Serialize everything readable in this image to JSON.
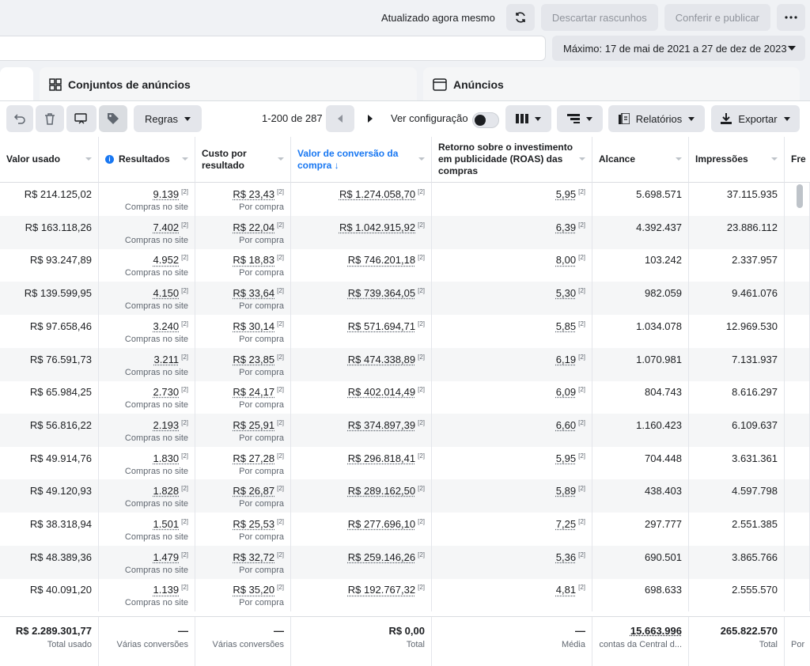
{
  "topbar": {
    "updated": "Atualizado agora mesmo",
    "discard": "Descartar rascunhos",
    "publish": "Conferir e publicar"
  },
  "date_range": "Máximo: 17 de mai de 2021 a 27 de dez de 2023",
  "tabs": {
    "adsets": "Conjuntos de anúncios",
    "ads": "Anúncios"
  },
  "toolbar": {
    "rules": "Regras",
    "page_range": "1-200 de 287",
    "view_config": "Ver configuração",
    "reports": "Relatórios",
    "export": "Exportar"
  },
  "columns": {
    "spent": "Valor usado",
    "results": "Resultados",
    "cost": "Custo por resultado",
    "conv_value": "Valor de conversão da compra ↓",
    "roas": "Retorno sobre o investimento em publicidade (ROAS) das compras",
    "reach": "Alcance",
    "impressions": "Impressões",
    "freq": "Fre"
  },
  "ref_mark": "[2]",
  "sub_results": "Compras no site",
  "sub_cost": "Por compra",
  "rows": [
    {
      "spent": "R$ 214.125,02",
      "results": "9.139",
      "cost": "R$ 23,43",
      "conv": "R$ 1.274.058,70",
      "roas": "5,95",
      "reach": "5.698.571",
      "impr": "37.115.935"
    },
    {
      "spent": "R$ 163.118,26",
      "results": "7.402",
      "cost": "R$ 22,04",
      "conv": "R$ 1.042.915,92",
      "roas": "6,39",
      "reach": "4.392.437",
      "impr": "23.886.112"
    },
    {
      "spent": "R$ 93.247,89",
      "results": "4.952",
      "cost": "R$ 18,83",
      "conv": "R$ 746.201,18",
      "roas": "8,00",
      "reach": "103.242",
      "impr": "2.337.957"
    },
    {
      "spent": "R$ 139.599,95",
      "results": "4.150",
      "cost": "R$ 33,64",
      "conv": "R$ 739.364,05",
      "roas": "5,30",
      "reach": "982.059",
      "impr": "9.461.076"
    },
    {
      "spent": "R$ 97.658,46",
      "results": "3.240",
      "cost": "R$ 30,14",
      "conv": "R$ 571.694,71",
      "roas": "5,85",
      "reach": "1.034.078",
      "impr": "12.969.530"
    },
    {
      "spent": "R$ 76.591,73",
      "results": "3.211",
      "cost": "R$ 23,85",
      "conv": "R$ 474.338,89",
      "roas": "6,19",
      "reach": "1.070.981",
      "impr": "7.131.937"
    },
    {
      "spent": "R$ 65.984,25",
      "results": "2.730",
      "cost": "R$ 24,17",
      "conv": "R$ 402.014,49",
      "roas": "6,09",
      "reach": "804.743",
      "impr": "8.616.297"
    },
    {
      "spent": "R$ 56.816,22",
      "results": "2.193",
      "cost": "R$ 25,91",
      "conv": "R$ 374.897,39",
      "roas": "6,60",
      "reach": "1.160.423",
      "impr": "6.109.637"
    },
    {
      "spent": "R$ 49.914,76",
      "results": "1.830",
      "cost": "R$ 27,28",
      "conv": "R$ 296.818,41",
      "roas": "5,95",
      "reach": "704.448",
      "impr": "3.631.361"
    },
    {
      "spent": "R$ 49.120,93",
      "results": "1.828",
      "cost": "R$ 26,87",
      "conv": "R$ 289.162,50",
      "roas": "5,89",
      "reach": "438.403",
      "impr": "4.597.798"
    },
    {
      "spent": "R$ 38.318,94",
      "results": "1.501",
      "cost": "R$ 25,53",
      "conv": "R$ 277.696,10",
      "roas": "7,25",
      "reach": "297.777",
      "impr": "2.551.385"
    },
    {
      "spent": "R$ 48.389,36",
      "results": "1.479",
      "cost": "R$ 32,72",
      "conv": "R$ 259.146,26",
      "roas": "5,36",
      "reach": "690.501",
      "impr": "3.865.766"
    },
    {
      "spent": "R$ 40.091,20",
      "results": "1.139",
      "cost": "R$ 35,20",
      "conv": "R$ 192.767,32",
      "roas": "4,81",
      "reach": "698.633",
      "impr": "2.555.570"
    }
  ],
  "footer": {
    "spent": "R$ 2.289.301,77",
    "spent_sub": "Total usado",
    "results": "—",
    "results_sub": "Várias conversões",
    "cost": "—",
    "cost_sub": "Várias conversões",
    "conv": "R$ 0,00",
    "conv_sub": "Total",
    "roas": "—",
    "roas_sub": "Média",
    "reach": "15.663.996",
    "reach_sub": "contas da Central d...",
    "impr": "265.822.570",
    "impr_sub": "Total",
    "freq_sub": "Por"
  },
  "icons": [
    "refresh-icon",
    "more-icon",
    "undo-icon",
    "trash-icon",
    "duplicate-icon",
    "tag-icon",
    "prev-page-icon",
    "next-page-icon",
    "columns-icon",
    "breakdown-icon",
    "reports-icon",
    "export-icon",
    "adsets-icon",
    "ads-icon",
    "info-icon"
  ]
}
